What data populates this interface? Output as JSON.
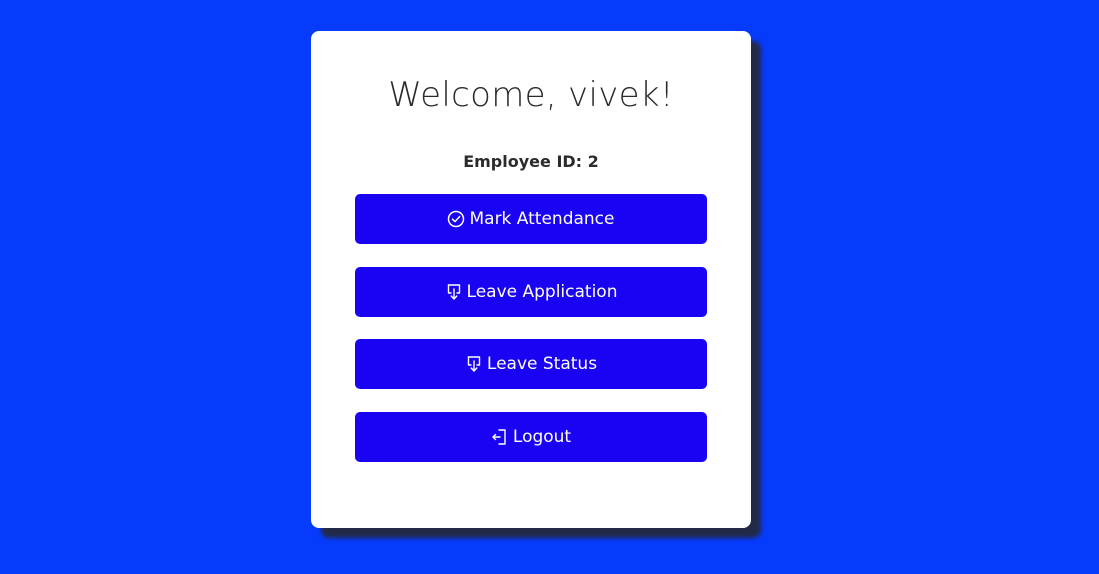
{
  "card": {
    "title": "Welcome, vivek!",
    "employee_id": "Employee ID: 2"
  },
  "buttons": {
    "mark_attendance": {
      "label": "Mark Attendance",
      "icon": "check-circle-icon"
    },
    "leave_application": {
      "label": "Leave Application",
      "icon": "download-file-icon"
    },
    "leave_status": {
      "label": "Leave Status",
      "icon": "download-file-icon"
    },
    "logout": {
      "label": "Logout",
      "icon": "logout-icon"
    }
  },
  "colors": {
    "background": "#073bfb",
    "button": "#1a03f2",
    "card": "#ffffff"
  }
}
